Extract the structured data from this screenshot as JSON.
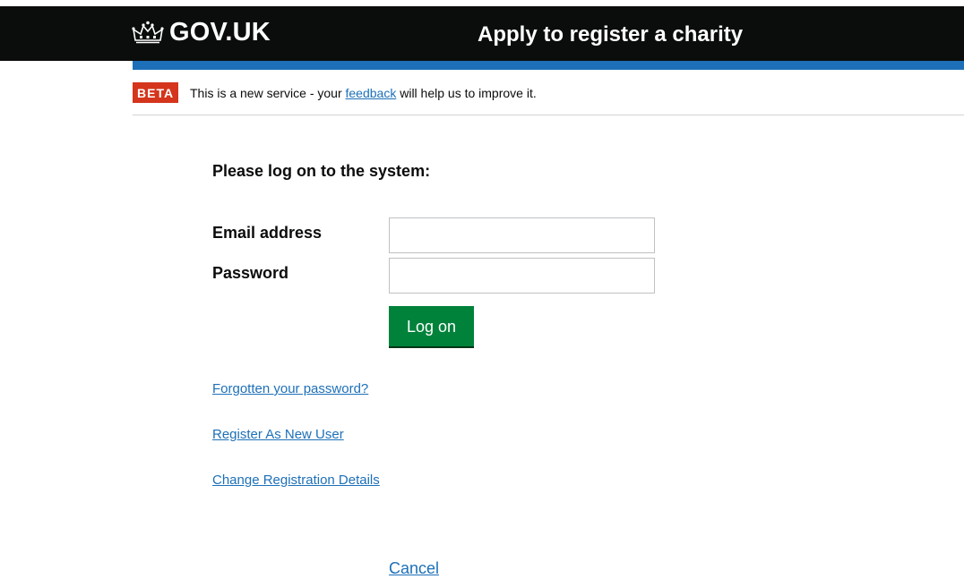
{
  "header": {
    "logo_text": "GOV.UK",
    "service_name": "Apply to register a charity",
    "logo_icon": "crown-icon"
  },
  "phase_banner": {
    "tag": "BETA",
    "text_before": "This is a new service - your ",
    "link_text": "feedback",
    "text_after": " will help us to improve it."
  },
  "main": {
    "heading": "Please log on to the system:",
    "email_label": "Email address",
    "email_value": "",
    "password_label": "Password",
    "password_value": "",
    "login_button": "Log on",
    "links": {
      "forgot": "Forgotten your password?",
      "register": "Register As New User",
      "change": "Change Registration Details",
      "cancel": "Cancel"
    }
  },
  "colors": {
    "header_bg": "#0b0c0c",
    "header_accent": "#1d70b8",
    "beta_tag": "#d4351c",
    "link": "#1d70b8",
    "button": "#00823b"
  }
}
